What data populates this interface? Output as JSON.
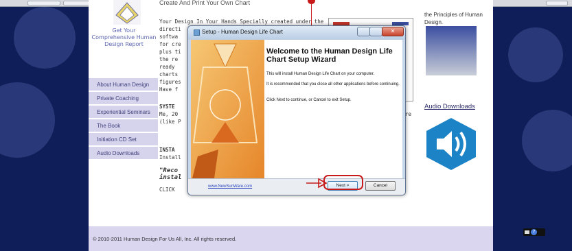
{
  "site": {
    "report_link": "Get Your Comprehensive Human Design Report",
    "nav": [
      {
        "label": "About Human Design"
      },
      {
        "label": "Private Coaching"
      },
      {
        "label": "Experiential Seminars"
      },
      {
        "label": "The Book"
      },
      {
        "label": "Initiation CD Set"
      },
      {
        "label": "Audio Downloads"
      }
    ],
    "content": {
      "heading": "Create And Print Your Own Chart",
      "lines": [
        "Your Design In Your Hands Specially created under the",
        "directi",
        "softwa",
        "for cre",
        "plus ti",
        "the re",
        "ready",
        "charts",
        "figures",
        "Have f"
      ],
      "system_label": "SYSTE",
      "system_lines": [
        "Me, 20",
        "(like P"
      ],
      "right_fragment": "re",
      "install_label": "INSTA",
      "install_line": "Install",
      "quote_1": "\"Reco",
      "quote_2": "instal",
      "click_line": "CLICK"
    },
    "right_column": {
      "intro_text": "the Principles of Human Design.",
      "audio_downloads_link": "Audio Downloads"
    },
    "footer": {
      "copyright": "© 2010-2011 Human Design For Us All, Inc. All rights reserved."
    }
  },
  "dialog": {
    "title": "Setup - Human Design Life Chart",
    "close_glyph": "✕",
    "welcome_heading": "Welcome to the Human Design Life Chart Setup Wizard",
    "line_1": "This will install Human Design Life Chart on your computer.",
    "line_2": "It is recommended that you close all other applications before continuing.",
    "line_3": "Click Next to continue, or Cancel to exit Setup.",
    "brand_link": "www.NewSunWare.com",
    "next_label": "Next >",
    "cancel_label": "Cancel"
  },
  "tray": {
    "help_glyph": "?"
  },
  "colors": {
    "background": "#0f1d58",
    "nav_bg": "#d6d3ec",
    "footer_bg": "#dad6f0",
    "annotation_red": "#c81a1a",
    "speaker_blue": "#1c84c6",
    "banner_orange": "#f2a94a"
  },
  "icons": {
    "logo": "human-design-bodygraph-logo",
    "dialog": "setup-icon",
    "speaker": "speaker-icon",
    "arrow": "red-arrow-icon"
  }
}
